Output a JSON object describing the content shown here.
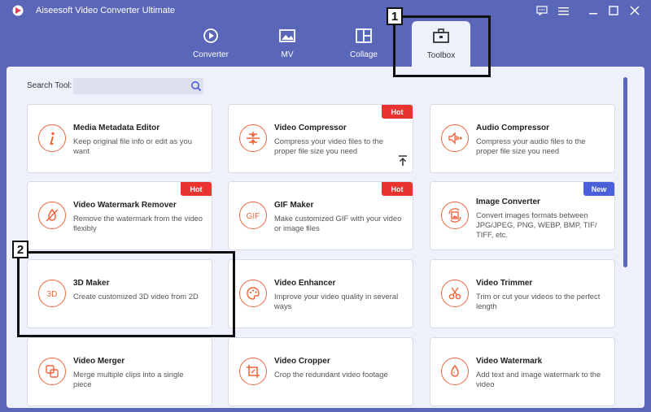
{
  "app": {
    "title": "Aiseesoft Video Converter Ultimate"
  },
  "nav": {
    "tabs": [
      {
        "label": "Converter",
        "icon": "converter-icon"
      },
      {
        "label": "MV",
        "icon": "mv-icon"
      },
      {
        "label": "Collage",
        "icon": "collage-icon"
      },
      {
        "label": "Toolbox",
        "icon": "toolbox-icon",
        "active": true
      }
    ]
  },
  "search": {
    "label": "Search Tool:",
    "value": ""
  },
  "tools": [
    {
      "title": "Media Metadata Editor",
      "desc": "Keep original file info or edit as you want",
      "icon": "info-icon"
    },
    {
      "title": "Video Compressor",
      "desc": "Compress your video files to the proper file size you need",
      "icon": "compress-icon",
      "badge": "Hot"
    },
    {
      "title": "Audio Compressor",
      "desc": "Compress your audio files to the proper file size you need",
      "icon": "audio-compress-icon"
    },
    {
      "title": "Video Watermark Remover",
      "desc": "Remove the watermark from the video flexibly",
      "icon": "watermark-remove-icon",
      "badge": "Hot"
    },
    {
      "title": "GIF Maker",
      "desc": "Make customized GIF with your video or image files",
      "icon": "gif-icon",
      "badge": "Hot"
    },
    {
      "title": "Image Converter",
      "desc": "Convert images formats between JPG/JPEG, PNG, WEBP, BMP, TIF/ TIFF, etc.",
      "icon": "image-convert-icon",
      "badge": "New"
    },
    {
      "title": "3D Maker",
      "desc": "Create customized 3D video from 2D",
      "icon": "3d-icon"
    },
    {
      "title": "Video Enhancer",
      "desc": "Improve your video quality in several ways",
      "icon": "palette-icon"
    },
    {
      "title": "Video Trimmer",
      "desc": "Trim or cut your videos to the perfect length",
      "icon": "scissors-icon"
    },
    {
      "title": "Video Merger",
      "desc": "Merge multiple clips into a single piece",
      "icon": "merge-icon"
    },
    {
      "title": "Video Cropper",
      "desc": "Crop the redundant video footage",
      "icon": "crop-icon"
    },
    {
      "title": "Video Watermark",
      "desc": "Add text and image watermark to the video",
      "icon": "watermark-icon"
    }
  ],
  "callouts": [
    {
      "number": "1"
    },
    {
      "number": "2"
    }
  ],
  "colors": {
    "accent": "#5a66b8",
    "icon": "#f0643c",
    "hot": "#e8332f",
    "new": "#4b5fd8"
  }
}
